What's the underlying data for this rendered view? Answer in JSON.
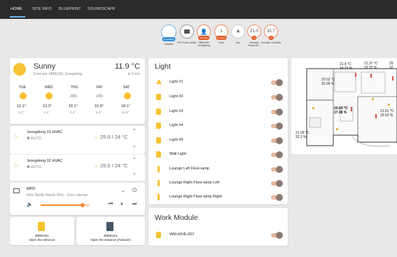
{
  "tabs": [
    {
      "label": "HOME"
    },
    {
      "label": "SITE INFO"
    },
    {
      "label": "BLUEPRINT"
    },
    {
      "label": "SOUNDSCAPE"
    }
  ],
  "status": {
    "badges": [
      {
        "value": "",
        "pill": "no updates",
        "label": "Updates"
      },
      {
        "value": "",
        "pill": "",
        "label": "RPi Power status"
      },
      {
        "value": "",
        "pill": "unknown",
        "label": "JIBMUSIL Jeongdong"
      },
      {
        "value": "1",
        "pill": "pending",
        "label": "hass"
      },
      {
        "value": "",
        "pill": "",
        "label": "Sun"
      },
      {
        "value": "21.0",
        "pill": "°C",
        "label": "Average Temperat..."
      },
      {
        "value": "32.7",
        "pill": "%",
        "label": "Average Humidity"
      }
    ]
  },
  "weather": {
    "condition": "Sunny",
    "forecast_label": "Forecast JIBMUSIL Jeongdong",
    "temperature": "11.9 °C",
    "wind": "0 m/s",
    "days": [
      {
        "day": "TUE",
        "hi": "12.1°",
        "lo": "3.1°"
      },
      {
        "day": "WED",
        "hi": "13.3°",
        "lo": "2.6°"
      },
      {
        "day": "THU",
        "hi": "16.1°",
        "lo": "3.4°"
      },
      {
        "day": "FRI",
        "hi": "15.9°",
        "lo": "8.4°"
      },
      {
        "day": "SAT",
        "hi": "18.1°",
        "lo": "10.3°"
      }
    ]
  },
  "hvac": [
    {
      "name": "Jeongdong 01 HVAC",
      "mode": "AUTO",
      "reading": "25.0 / 24 °C"
    },
    {
      "name": "Jeongdong 02 HVAC",
      "mode": "AUTO",
      "reading": "25.0 / 24 °C"
    }
  ],
  "media": {
    "player": "MPD",
    "track": "Who Really Needs Who - Jens Lekman",
    "progress": 0.86
  },
  "entrances": [
    {
      "name": "JIBMUSIL",
      "action": "Open the entrance"
    },
    {
      "name": "JIBMUSIL",
      "action": "Open the entrance (Failover)"
    }
  ],
  "lights": {
    "title": "Light",
    "items": [
      {
        "label": "Light #1"
      },
      {
        "label": "Light #2"
      },
      {
        "label": "Light #3"
      },
      {
        "label": "Light #4"
      },
      {
        "label": "Light #5"
      },
      {
        "label": "Wall Light"
      },
      {
        "label": "Lounge Left Floor-lamp"
      },
      {
        "label": "Lounge Right Floor-lamp Left"
      },
      {
        "label": "Lounge Right Floor-lamp Right"
      }
    ]
  },
  "work_module": {
    "title": "Work Module",
    "items": [
      {
        "label": "WM-HIVE-007"
      }
    ]
  },
  "floorplan": {
    "readings": [
      {
        "t": "21.4 °C",
        "h": "34.74 %"
      },
      {
        "t": "21.37 °C",
        "h": "33.32 %"
      },
      {
        "t": "20.52 °C",
        "h": "33.99 %"
      },
      {
        "t": "20.83 °C",
        "h": "27.88 %"
      },
      {
        "t": "21.51 °C",
        "h": "29.63 %"
      },
      {
        "t": "21.56 °C",
        "h": "32.2 %"
      },
      {
        "t": "20",
        "h": "32"
      }
    ]
  },
  "colors": {
    "accent": "#e15b2b",
    "blue": "#3a8fd8",
    "sun": "#f5c230"
  }
}
